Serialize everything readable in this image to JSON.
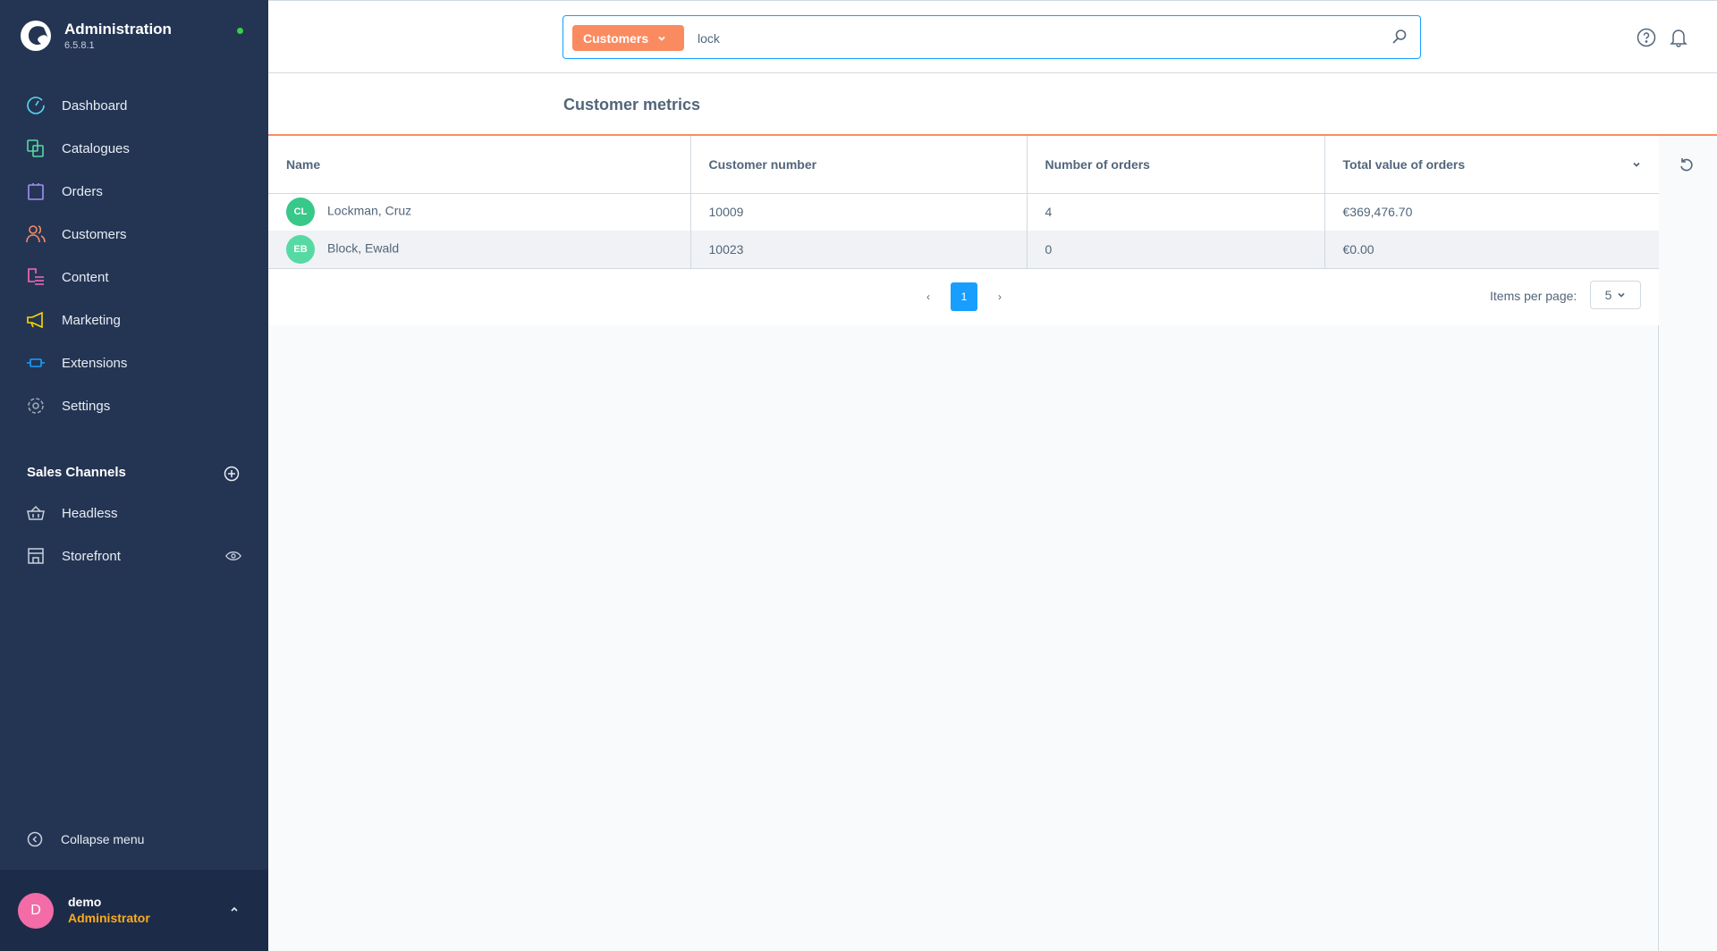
{
  "app": {
    "title": "Administration",
    "version": "6.5.8.1"
  },
  "sidebar": {
    "items": [
      {
        "label": "Dashboard",
        "icon": "dashboard-icon",
        "color": "#57d9f3"
      },
      {
        "label": "Catalogues",
        "icon": "catalogues-icon",
        "color": "#57d9a3"
      },
      {
        "label": "Orders",
        "icon": "orders-icon",
        "color": "#a092f0"
      },
      {
        "label": "Customers",
        "icon": "customers-icon",
        "color": "#f88962"
      },
      {
        "label": "Content",
        "icon": "content-icon",
        "color": "#ff68b4"
      },
      {
        "label": "Marketing",
        "icon": "marketing-icon",
        "color": "#ffd700"
      },
      {
        "label": "Extensions",
        "icon": "extensions-icon",
        "color": "#189eff"
      },
      {
        "label": "Settings",
        "icon": "settings-icon",
        "color": "#9aa8b5"
      }
    ],
    "sales_channels_title": "Sales Channels",
    "sales_channels": [
      {
        "label": "Headless"
      },
      {
        "label": "Storefront"
      }
    ],
    "collapse_label": "Collapse menu",
    "user": {
      "initial": "D",
      "name": "demo",
      "role": "Administrator"
    }
  },
  "search": {
    "type": "Customers",
    "value": "lock"
  },
  "page": {
    "title": "Customer metrics"
  },
  "table": {
    "columns": [
      "Name",
      "Customer number",
      "Number of orders",
      "Total value of orders"
    ],
    "rows": [
      {
        "initials": "CL",
        "name": "Lockman, Cruz",
        "number": "10009",
        "orders": "4",
        "total": "€369,476.70",
        "avatar_color": "#37c88a"
      },
      {
        "initials": "EB",
        "name": "Block, Ewald",
        "number": "10023",
        "orders": "0",
        "total": "€0.00",
        "avatar_color": "#57d9a3"
      }
    ]
  },
  "pagination": {
    "current": "1",
    "items_per_page_label": "Items per page:",
    "items_per_page": "5"
  },
  "colors": {
    "sidebar": "#243554",
    "accent": "#fa8b61",
    "primary": "#189eff"
  }
}
